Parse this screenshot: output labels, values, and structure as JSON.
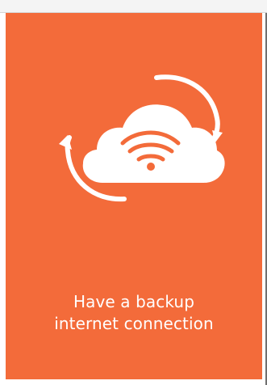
{
  "card": {
    "background_color": "#f36b3a",
    "icon": "cloud-wifi-sync-icon",
    "caption": {
      "line1": "Have a backup",
      "line2": "internet connection"
    }
  }
}
